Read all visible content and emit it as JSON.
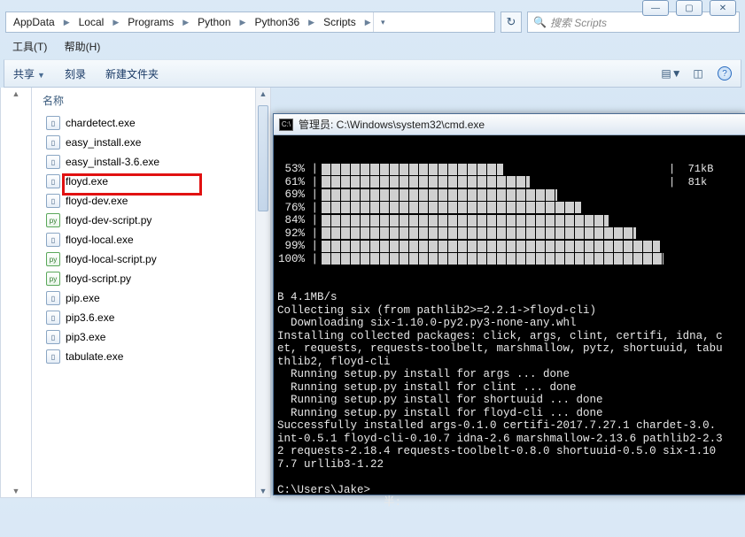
{
  "breadcrumb": [
    "AppData",
    "Local",
    "Programs",
    "Python",
    "Python36",
    "Scripts"
  ],
  "search": {
    "placeholder": "搜索 Scripts"
  },
  "menubar": {
    "tools": "工具(T)",
    "help": "帮助(H)"
  },
  "toolbar": {
    "share": "共享",
    "burn": "刻录",
    "newfolder": "新建文件夹"
  },
  "list": {
    "header": "名称",
    "files": [
      {
        "name": "chardetect.exe",
        "type": "exe"
      },
      {
        "name": "easy_install.exe",
        "type": "exe"
      },
      {
        "name": "easy_install-3.6.exe",
        "type": "exe"
      },
      {
        "name": "floyd.exe",
        "type": "exe",
        "highlight": true
      },
      {
        "name": "floyd-dev.exe",
        "type": "exe"
      },
      {
        "name": "floyd-dev-script.py",
        "type": "py"
      },
      {
        "name": "floyd-local.exe",
        "type": "exe"
      },
      {
        "name": "floyd-local-script.py",
        "type": "py"
      },
      {
        "name": "floyd-script.py",
        "type": "py"
      },
      {
        "name": "pip.exe",
        "type": "exe"
      },
      {
        "name": "pip3.6.exe",
        "type": "exe"
      },
      {
        "name": "pip3.exe",
        "type": "exe"
      },
      {
        "name": "tabulate.exe",
        "type": "exe"
      }
    ]
  },
  "cmd": {
    "title": "管理员: C:\\Windows\\system32\\cmd.exe",
    "progress": [
      {
        "pct": "53%",
        "fill": 47,
        "rate": "|  71kB"
      },
      {
        "pct": "61%",
        "fill": 39,
        "rate": "|  81k"
      },
      {
        "pct": "69%",
        "fill": 31,
        "rate": ""
      },
      {
        "pct": "76%",
        "fill": 24,
        "rate": ""
      },
      {
        "pct": "84%",
        "fill": 16,
        "rate": ""
      },
      {
        "pct": "92%",
        "fill": 8,
        "rate": ""
      },
      {
        "pct": "99%",
        "fill": 1,
        "rate": ""
      },
      {
        "pct": "100%",
        "fill": 0,
        "rate": ""
      }
    ],
    "lines": [
      "B 4.1MB/s",
      "Collecting six (from pathlib2>=2.2.1->floyd-cli)",
      "  Downloading six-1.10.0-py2.py3-none-any.whl",
      "Installing collected packages: click, args, clint, certifi, idna, c",
      "et, requests, requests-toolbelt, marshmallow, pytz, shortuuid, tabu",
      "thlib2, floyd-cli",
      "  Running setup.py install for args ... done",
      "  Running setup.py install for clint ... done",
      "  Running setup.py install for shortuuid ... done",
      "  Running setup.py install for floyd-cli ... done",
      "Successfully installed args-0.1.0 certifi-2017.7.27.1 chardet-3.0.",
      "int-0.5.1 floyd-cli-0.10.7 idna-2.6 marshmallow-2.13.6 pathlib2-2.3",
      "2 requests-2.18.4 requests-toolbelt-0.8.0 shortuuid-0.5.0 six-1.10",
      "7.7 urllib3-1.22",
      "",
      "C:\\Users\\Jake>",
      "                半:"
    ]
  }
}
